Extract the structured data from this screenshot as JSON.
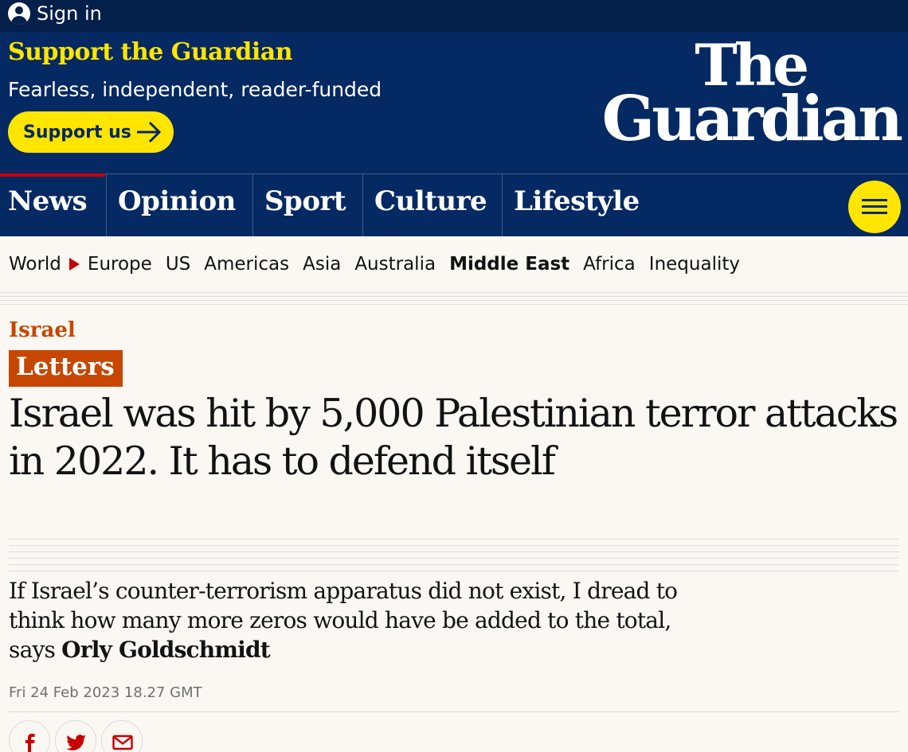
{
  "topbar": {
    "signin_label": "Sign in"
  },
  "masthead": {
    "support_title": "Support the Guardian",
    "support_subtitle": "Fearless, independent, reader-funded",
    "support_button": "Support us",
    "logo_line1": "The",
    "logo_line2": "Guardian"
  },
  "nav": {
    "pillars": [
      {
        "label": "News",
        "active": true
      },
      {
        "label": "Opinion"
      },
      {
        "label": "Sport"
      },
      {
        "label": "Culture"
      },
      {
        "label": "Lifestyle"
      }
    ]
  },
  "subnav": {
    "items": [
      "World",
      "Europe",
      "US",
      "Americas",
      "Asia",
      "Australia",
      "Middle East",
      "Africa",
      "Inequality"
    ],
    "current": "Middle East"
  },
  "article": {
    "kicker": "Israel",
    "badge": "Letters",
    "headline": "Israel was hit by 5,000 Palestinian terror attacks in 2022. It has to defend itself",
    "standfirst_text": "If Israel’s counter-terrorism apparatus did not exist, I dread to think how many more zeros would have be added to the total, says",
    "author": "Orly Goldschmidt",
    "date": "Fri 24 Feb 2023 18.27 GMT"
  },
  "share": {
    "icons": [
      "facebook-icon",
      "twitter-icon",
      "email-icon"
    ]
  },
  "colors": {
    "brand_blue": "#052962",
    "top_blue": "#041f4a",
    "yellow": "#ffe500",
    "news_red": "#c70000",
    "opinion_orange": "#c74600",
    "background": "#fbf7f3"
  }
}
